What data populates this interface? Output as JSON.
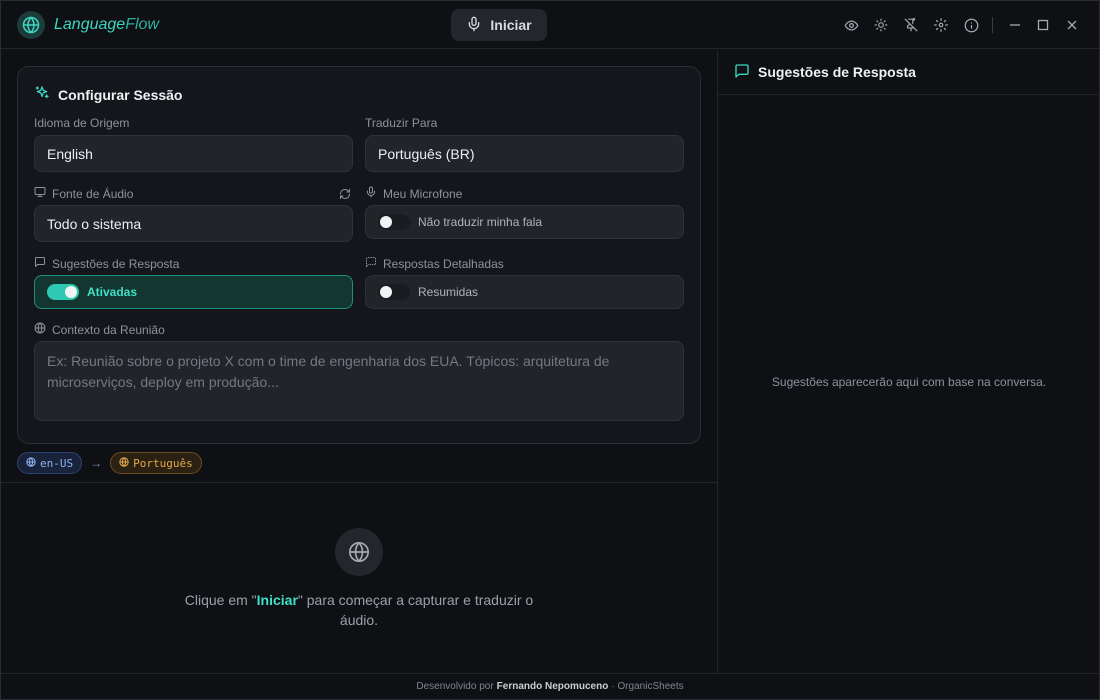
{
  "app": {
    "name_part1": "Language",
    "name_part2": "Flow"
  },
  "toolbar": {
    "start_label": "Iniciar"
  },
  "session": {
    "title": "Configurar Sessão",
    "source_language": {
      "label": "Idioma de Origem",
      "value": "English"
    },
    "target_language": {
      "label": "Traduzir Para",
      "value": "Português (BR)"
    },
    "audio_source": {
      "label": "Fonte de Áudio",
      "value": "Todo o sistema"
    },
    "microphone": {
      "label": "Meu Microfone",
      "toggle_label": "Não traduzir minha fala",
      "enabled": false
    },
    "suggestions": {
      "label": "Sugestões de Resposta",
      "toggle_label": "Ativadas",
      "enabled": true
    },
    "detailed": {
      "label": "Respostas Detalhadas",
      "toggle_label": "Resumidas",
      "enabled": false
    },
    "context": {
      "label": "Contexto da Reunião",
      "placeholder": "Ex: Reunião sobre o projeto X com o time de engenharia dos EUA. Tópicos: arquitetura de microserviços, deploy em produção..."
    }
  },
  "language_chips": {
    "source": "en-US",
    "arrow": "→",
    "target": "Português"
  },
  "empty_state": {
    "text_before": "Clique em \"",
    "highlight": "Iniciar",
    "text_after": "\" para começar a capturar e traduzir o áudio."
  },
  "suggestions_panel": {
    "title": "Sugestões de Resposta",
    "empty_text": "Sugestões aparecerão aqui com base na conversa."
  },
  "footer": {
    "prefix": "Desenvolvido por",
    "author": "Fernando Nepomuceno",
    "suffix": "· OrganicSheets"
  },
  "colors": {
    "accent": "#3dd6c1",
    "source_chip": "#8fb1f0",
    "target_chip": "#e2a84b"
  },
  "icons": [
    "globe-icon",
    "mic-icon",
    "eye-icon",
    "sun-icon",
    "pin-off-icon",
    "gear-icon",
    "info-icon",
    "minimize-icon",
    "maximize-icon",
    "close-icon",
    "sparkles-icon",
    "monitor-icon",
    "refresh-icon",
    "message-icon"
  ]
}
